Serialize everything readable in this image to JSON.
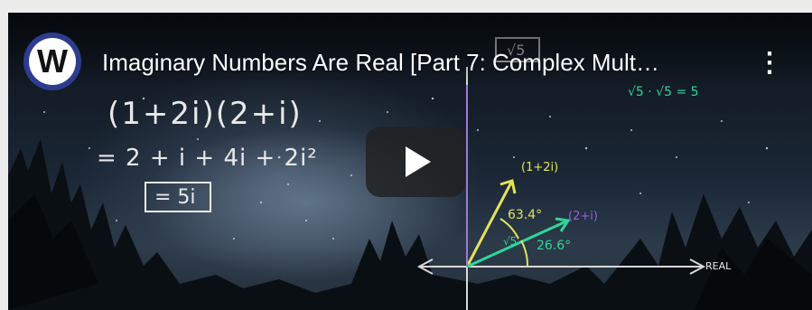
{
  "video": {
    "title": "Imaginary Numbers Are Real [Part 7: Complex Mult…",
    "channel_logo_letter": "W",
    "menu_icon": "kebab-vertical-icon",
    "play_icon": "play-icon"
  },
  "board": {
    "product_expr": "(1+2i)(2+i)",
    "expansion": "= 2 + i + 4i + 2i²",
    "result": "= 5i",
    "sqrt_note": "√5 · √5 = 5",
    "vector_a_label": "(1+2i)",
    "vector_b_label": "(2+i)",
    "angle_a": "63.4°",
    "angle_b": "26.6°",
    "length_label": "√5",
    "axis_label": "REAL",
    "boxed_top": "√5"
  },
  "colors": {
    "chalk": "#e8e8e8",
    "yellow": "#e2e35a",
    "green": "#2fd69a",
    "purple": "#8f62d8",
    "logo_ring": "#2d3c8f"
  }
}
